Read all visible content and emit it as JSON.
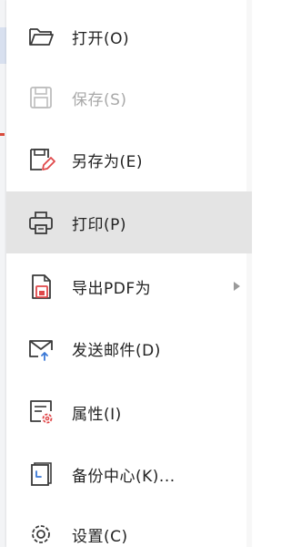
{
  "menu": {
    "items": [
      {
        "label": "打开(O)",
        "icon": "folder-open-icon"
      },
      {
        "label": "保存(S)",
        "icon": "save-icon",
        "disabled": true
      },
      {
        "label": "另存为(E)",
        "icon": "save-as-icon"
      },
      {
        "label": "打印(P)",
        "icon": "printer-icon",
        "active": true
      },
      {
        "label": "导出PDF为",
        "icon": "export-pdf-icon",
        "submenu": true
      },
      {
        "label": "发送邮件(D)",
        "icon": "mail-send-icon"
      },
      {
        "label": "属性(I)",
        "icon": "properties-icon"
      },
      {
        "label": "备份中心(K)...",
        "icon": "backup-center-icon"
      },
      {
        "label": "设置(C)",
        "icon": "settings-icon"
      }
    ]
  },
  "colors": {
    "hover_background": "#e4e4e4",
    "icon_stroke": "#3a3a3a",
    "icon_accent": "#e0484a",
    "icon_blue": "#3a78d6",
    "disabled_text": "#a8a8a8"
  }
}
